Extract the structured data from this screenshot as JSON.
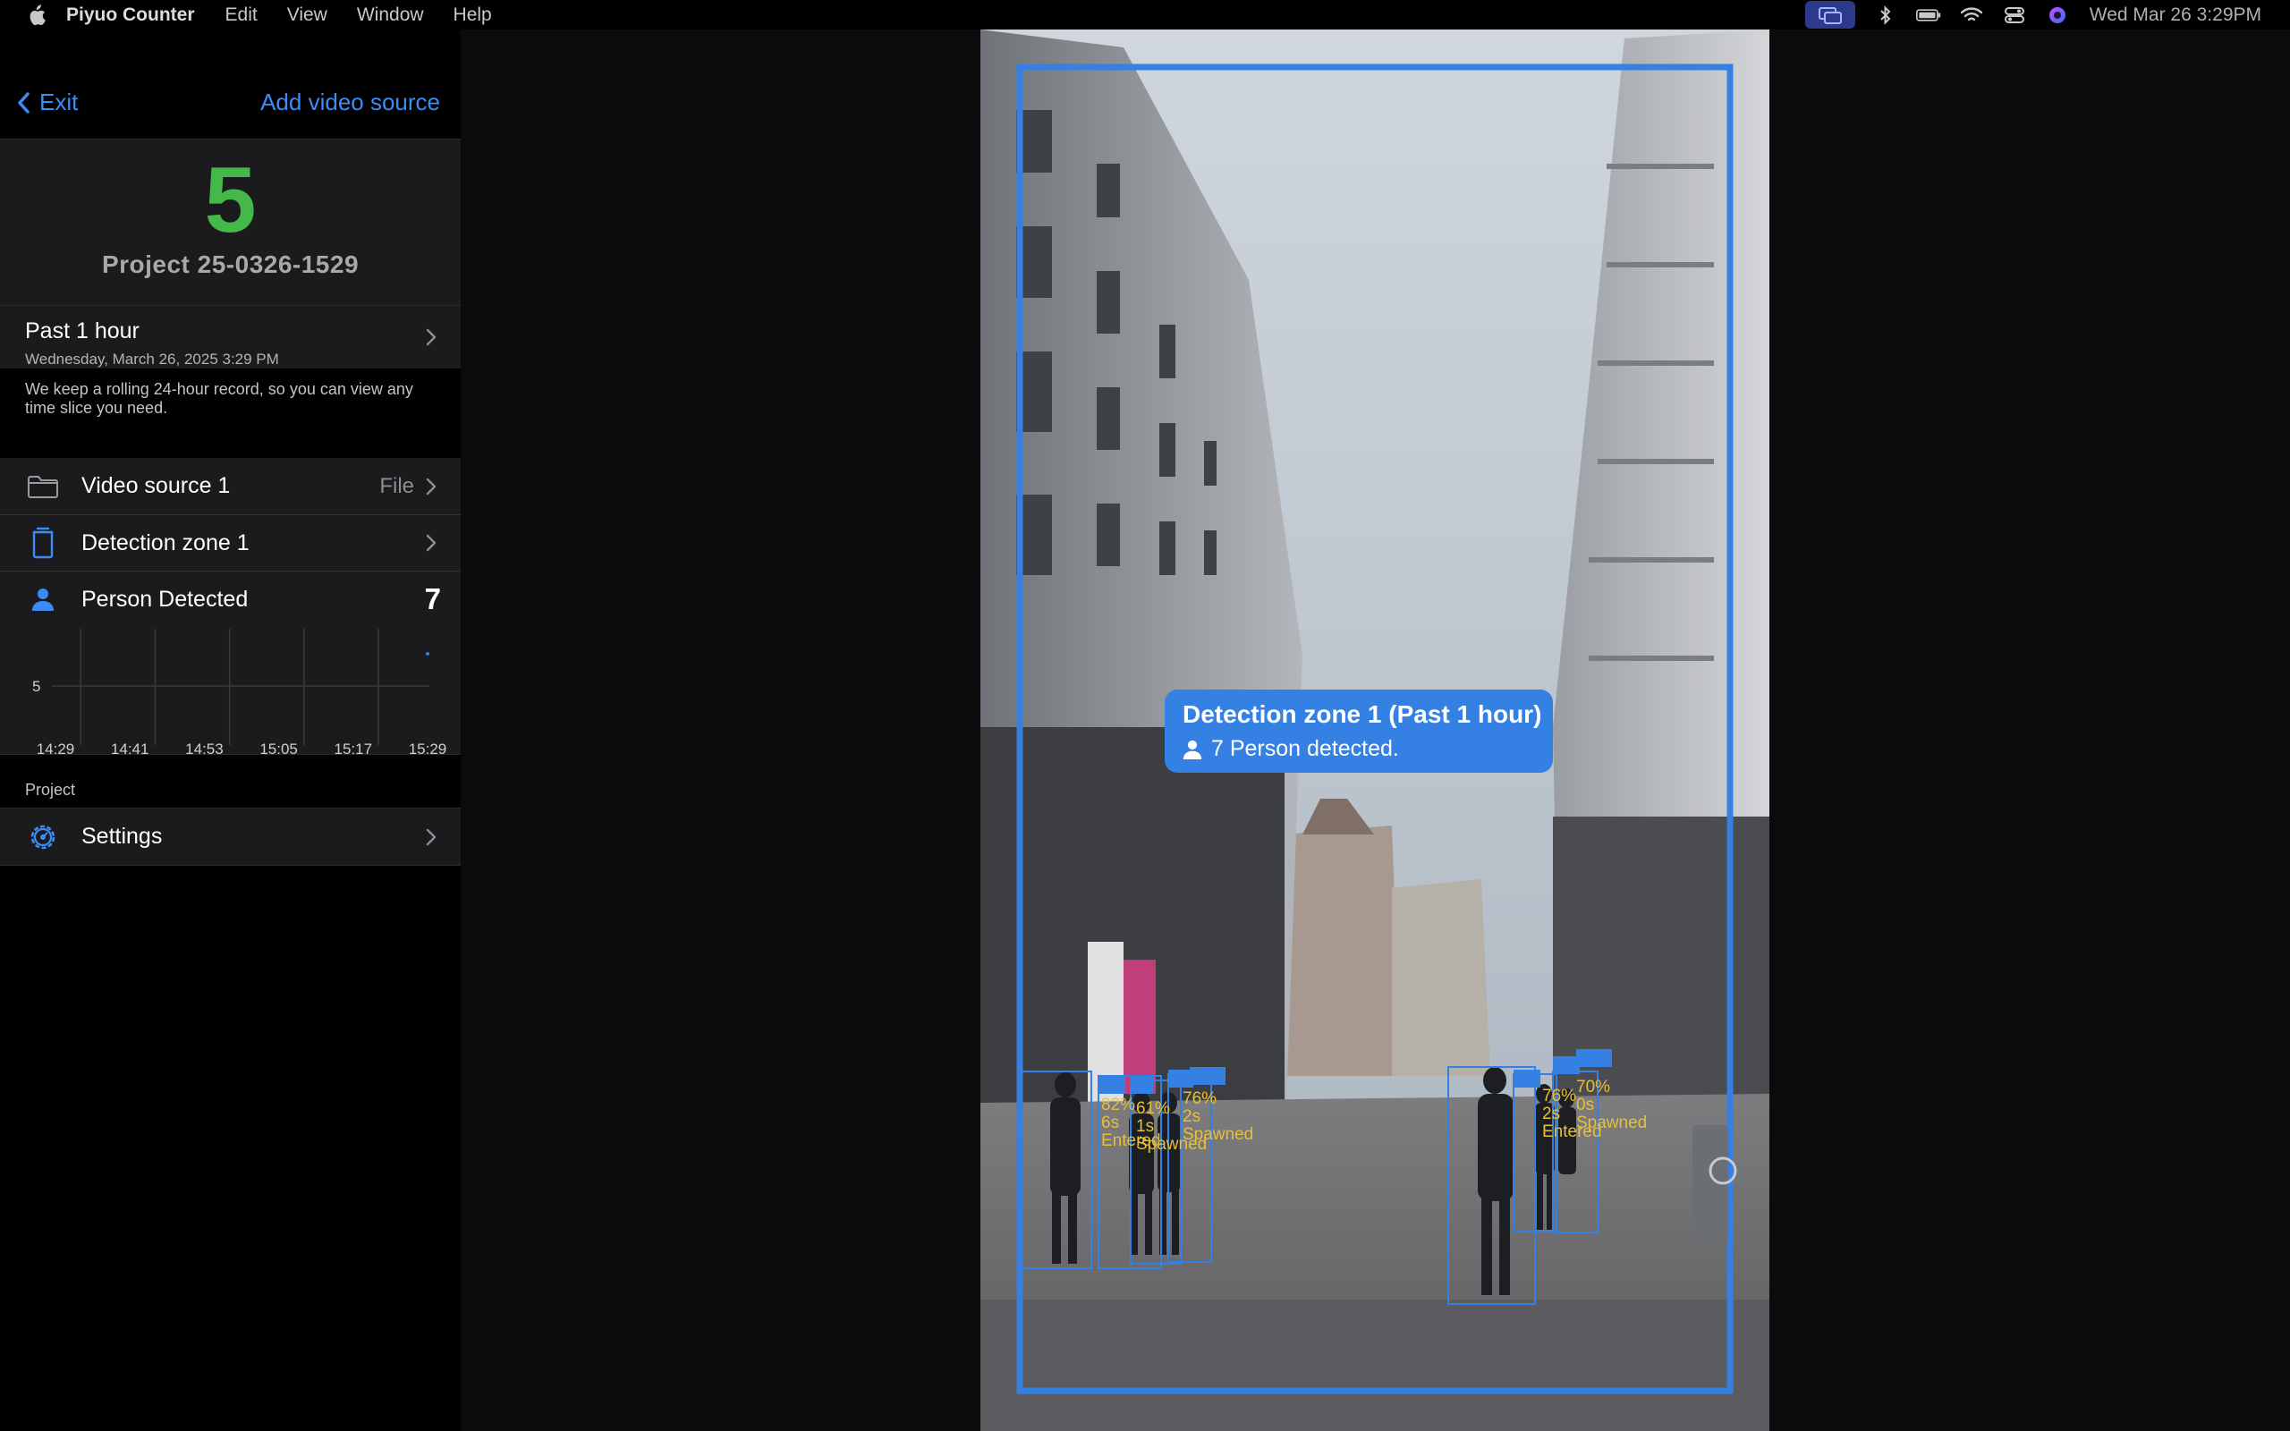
{
  "menubar": {
    "app_name": "Piyuo Counter",
    "menus": [
      "Edit",
      "View",
      "Window",
      "Help"
    ],
    "clock": "Wed Mar 26  3:29PM"
  },
  "nav": {
    "exit_label": "Exit",
    "add_source_label": "Add video source"
  },
  "counter": {
    "count": "5",
    "project_name": "Project 25-0326-1529",
    "count_color": "#44b94a"
  },
  "time_slice": {
    "title": "Past 1 hour",
    "date": "Wednesday, March 26, 2025 3:29 PM",
    "note": "We keep a rolling 24-hour record, so you can view any time slice you need."
  },
  "list": {
    "video_source": {
      "label": "Video source 1",
      "value": "File"
    },
    "detection_zone": {
      "label": "Detection zone 1"
    },
    "person_detected": {
      "label": "Person Detected",
      "count": "7"
    }
  },
  "chart_data": {
    "type": "line",
    "x": [
      "14:29",
      "14:41",
      "14:53",
      "15:05",
      "15:17",
      "15:29"
    ],
    "y_tick_labels": [
      "5"
    ],
    "series": [
      {
        "values": [
          null,
          null,
          null,
          null,
          null,
          5
        ]
      }
    ],
    "grid": true
  },
  "project_section": {
    "label": "Project",
    "settings_label": "Settings"
  },
  "overlay": {
    "tooltip_title": "Detection zone 1 (Past 1 hour)",
    "tooltip_sub": "7 Person detected.",
    "accent": "#3580e3"
  },
  "detections": [
    {
      "conf": "82%",
      "time": "6s",
      "state": "Entered"
    },
    {
      "conf": "61%",
      "time": "1s",
      "state": "Spawned"
    },
    {
      "conf": "76%",
      "time": "2s",
      "state": "Spawned"
    },
    {
      "conf": "76%",
      "time": "2s",
      "state": "Entered"
    },
    {
      "conf": "70%",
      "time": "0s",
      "state": "Spawned"
    }
  ]
}
